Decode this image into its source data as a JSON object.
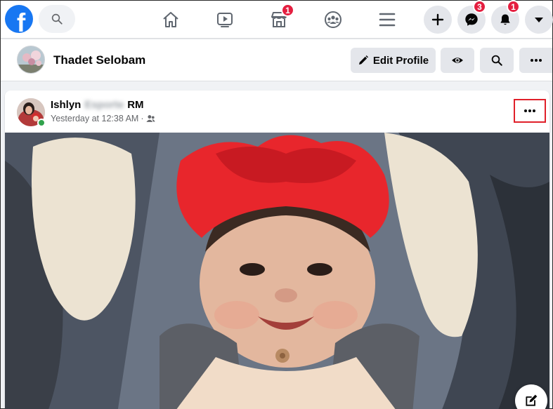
{
  "topbar": {
    "logo_letter": "f",
    "tabs": [
      {
        "name": "home-icon"
      },
      {
        "name": "watch-icon"
      },
      {
        "name": "marketplace-icon",
        "badge": "1"
      },
      {
        "name": "groups-icon"
      },
      {
        "name": "menu-icon"
      }
    ],
    "marketplace_badge": "1",
    "messenger_badge": "3",
    "notifications_badge": "1"
  },
  "profile": {
    "name": "Thadet Selobam",
    "edit_label": "Edit Profile"
  },
  "post": {
    "author_first": "Ishlyn",
    "author_hidden": "Esporte",
    "author_last": "RM",
    "timestamp": "Yesterday at 12:38 AM",
    "separator": "·",
    "audience_icon": "friends-icon"
  },
  "colors": {
    "brand": "#1877f2",
    "badge": "#e41e3f",
    "highlight": "#e0202a",
    "online": "#31a24c"
  }
}
